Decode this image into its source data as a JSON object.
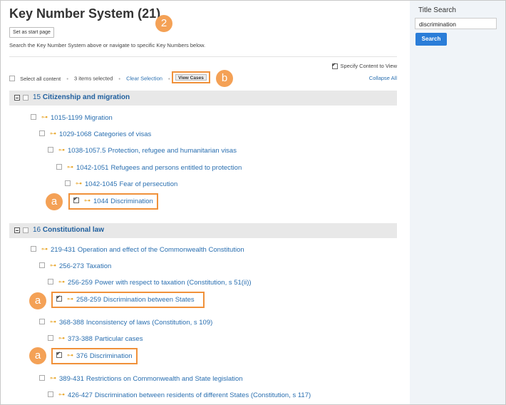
{
  "page": {
    "title": "Key Number System (21)",
    "start_label": "Set as start page",
    "help_text": "Search the Key Number System above or navigate to specific Key Numbers below.",
    "specify_label": "Specify Content to View",
    "callout_2": "2",
    "callout_b": "b",
    "callout_a": "a"
  },
  "toolbar": {
    "select_all": "Select all content",
    "items_selected": "3 items selected",
    "clear": "Clear Selection",
    "view_cases": "View Cases",
    "collapse_all": "Collapse All"
  },
  "sections": [
    {
      "num": "15",
      "title": "Citizenship and migration"
    },
    {
      "num": "16",
      "title": "Constitutional law"
    }
  ],
  "rows": [
    {
      "num": "1015-1199",
      "label": "Migration",
      "checked": false
    },
    {
      "num": "1029-1068",
      "label": "Categories of visas",
      "checked": false
    },
    {
      "num": "1038-1057.5",
      "label": "Protection, refugee and humanitarian visas",
      "checked": false
    },
    {
      "num": "1042-1051",
      "label": "Refugees and persons entitled to protection",
      "checked": false
    },
    {
      "num": "1042-1045",
      "label": "Fear of persecution",
      "checked": false
    },
    {
      "num": "1044",
      "label": "Discrimination",
      "checked": true
    },
    {
      "num": "219-431",
      "label": "Operation and effect of the Commonwealth Constitution",
      "checked": false
    },
    {
      "num": "256-273",
      "label": "Taxation",
      "checked": false
    },
    {
      "num": "256-259",
      "label": "Power with respect to taxation (Constitution, s 51(ii))",
      "checked": false
    },
    {
      "num": "258-259",
      "label": "Discrimination between States",
      "checked": true
    },
    {
      "num": "368-388",
      "label": "Inconsistency of laws (Constitution, s 109)",
      "checked": false
    },
    {
      "num": "373-388",
      "label": "Particular cases",
      "checked": false
    },
    {
      "num": "376",
      "label": "Discrimination",
      "checked": true
    },
    {
      "num": "389-431",
      "label": "Restrictions on Commonwealth and State legislation",
      "checked": false
    },
    {
      "num": "426-427",
      "label": "Discrimination between residents of different States (Constitution, s 117)",
      "checked": false
    }
  ],
  "sidebar": {
    "label": "Title Search",
    "input_value": "discrimination",
    "button": "Search"
  },
  "colors": {
    "accent": "#f0913a",
    "link": "#2a6fb0",
    "button": "#2a7dd8"
  },
  "icons": {
    "key": "key-icon",
    "collapse": "minus-box-icon"
  }
}
